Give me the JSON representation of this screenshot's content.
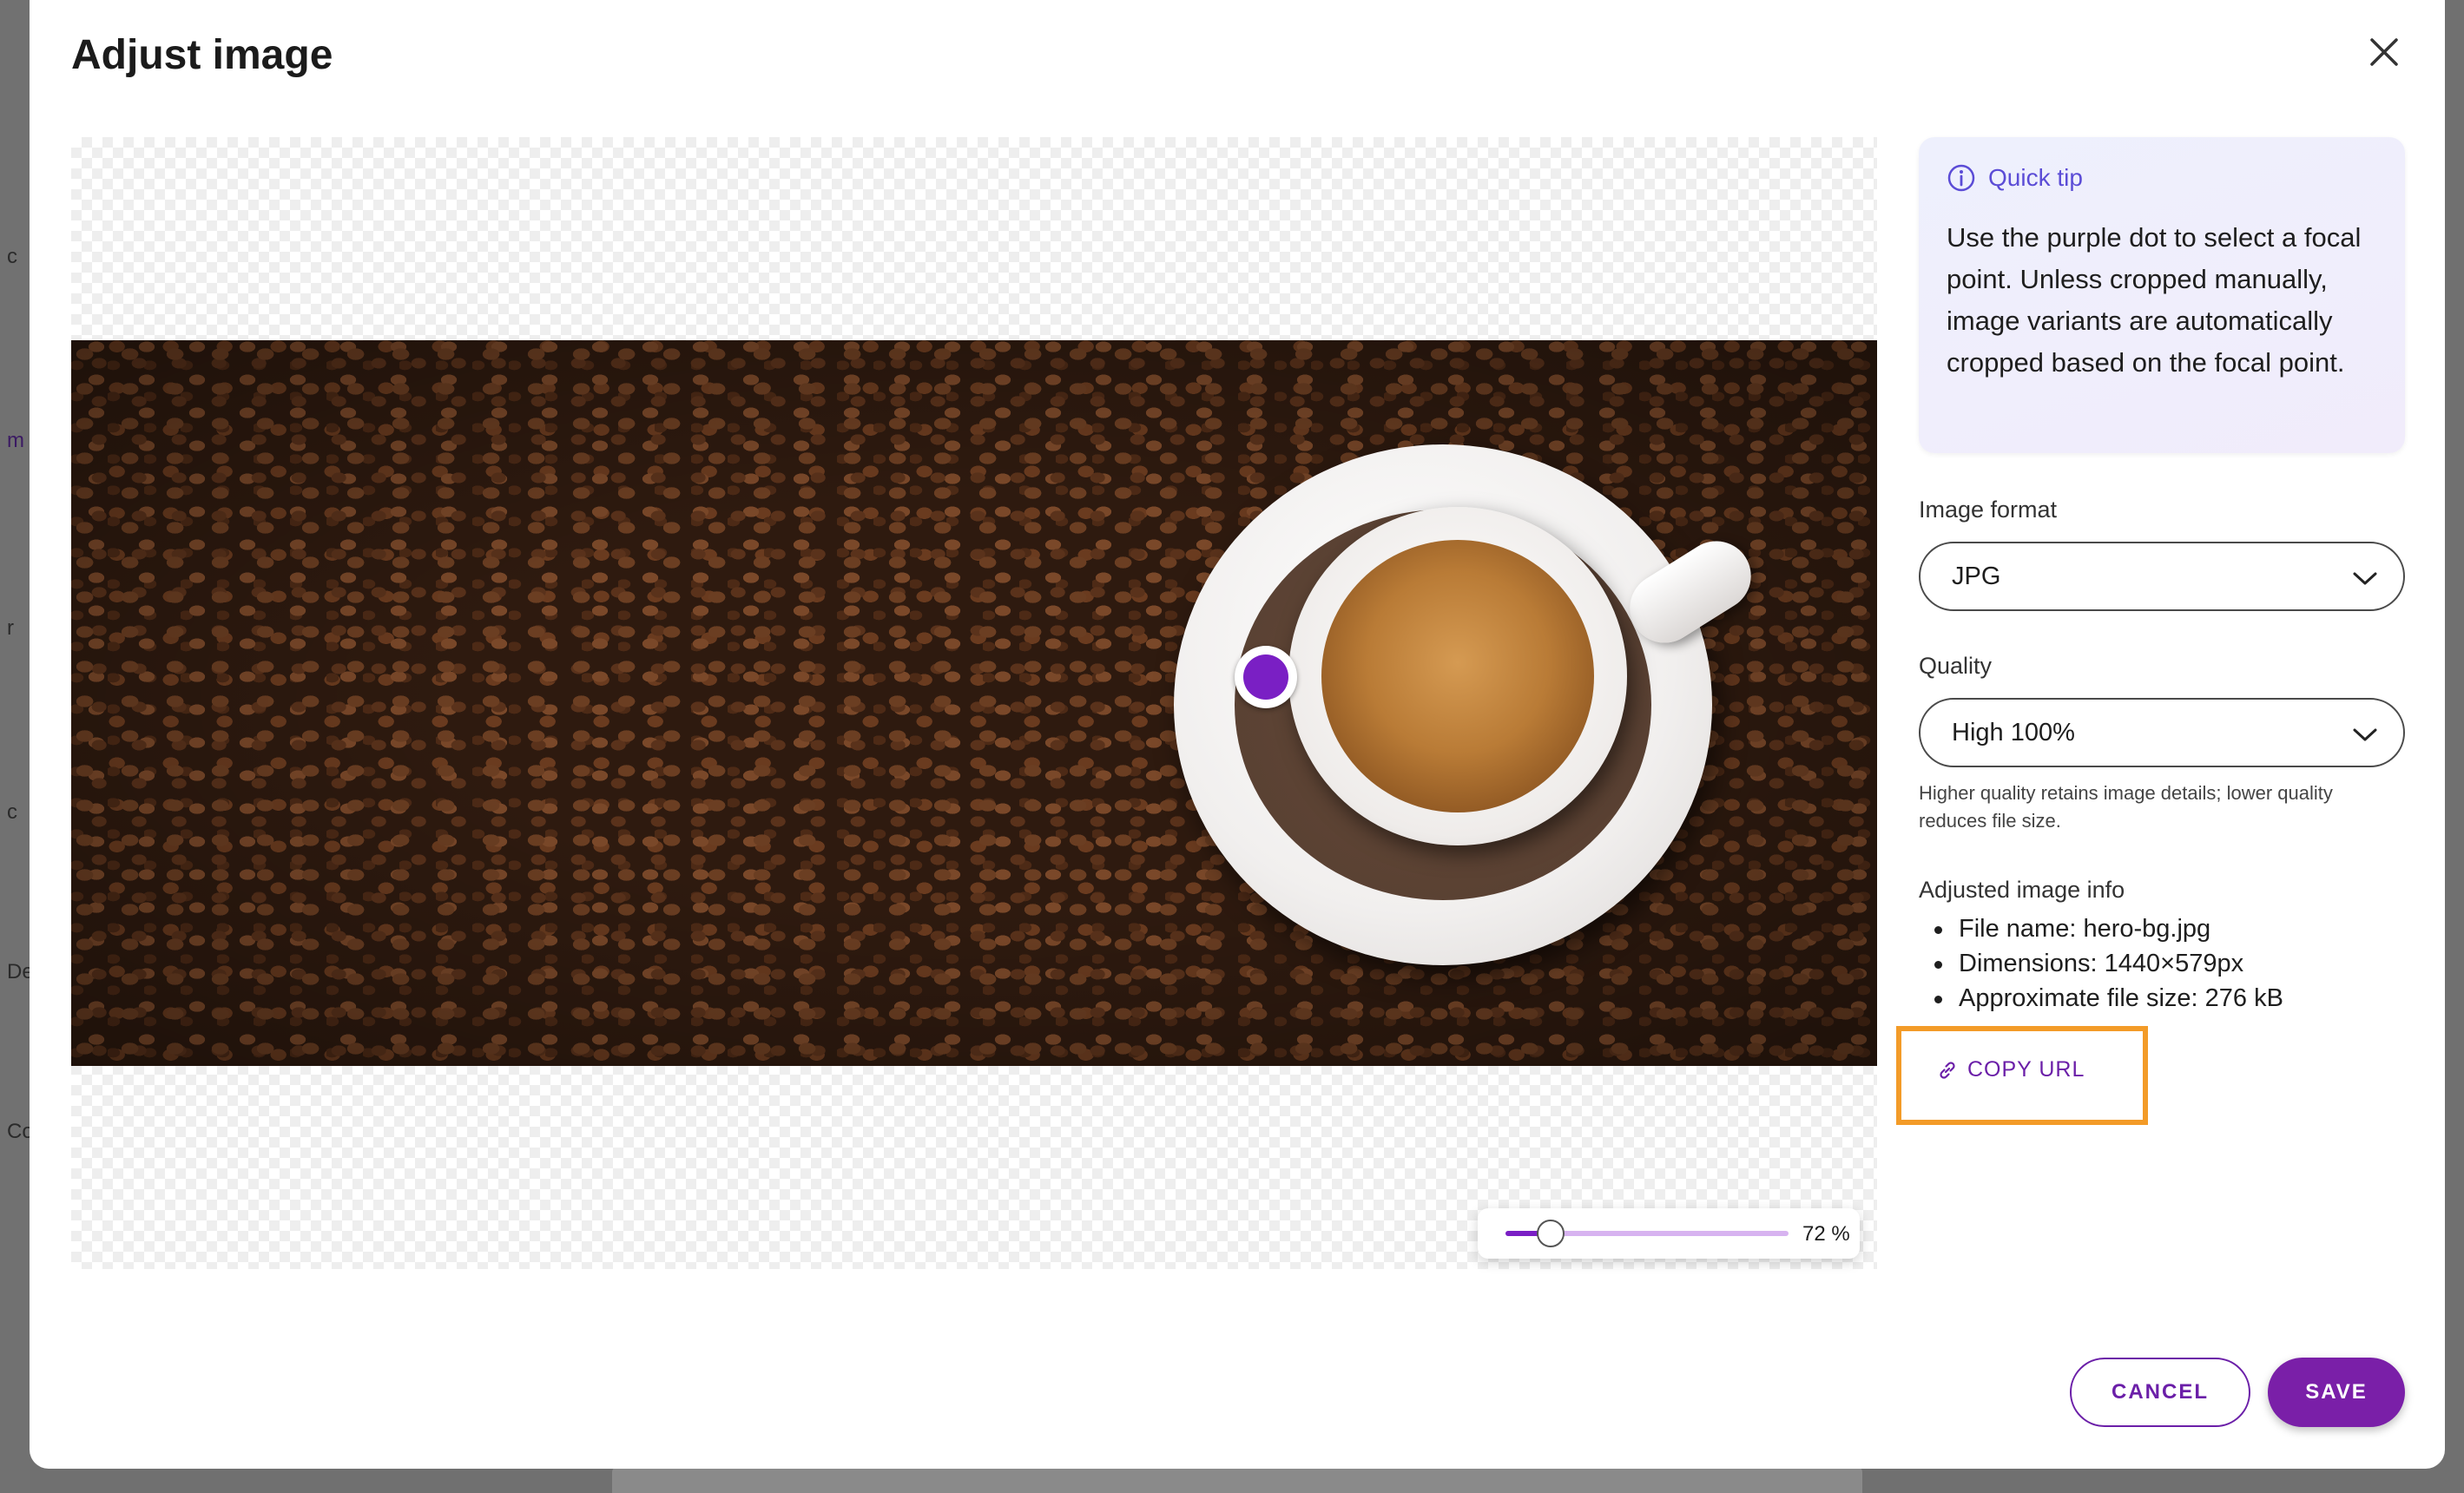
{
  "background_fragments": [
    "c",
    "m",
    "r",
    "c",
    "De",
    "Co"
  ],
  "modal": {
    "title": "Adjust image",
    "close_icon": "close-icon"
  },
  "image": {
    "alt_icon": "focal-point-dot",
    "zoom": {
      "value_percent": 72,
      "min_percent": 0,
      "max_percent": 100,
      "label": "72 %",
      "slider_position_fraction": 0.16
    }
  },
  "tip": {
    "icon": "info-icon",
    "title": "Quick tip",
    "body": "Use the purple dot to select a focal point. Unless cropped manually, image variants are automatically cropped based on the focal point."
  },
  "format": {
    "label": "Image format",
    "value": "JPG"
  },
  "quality": {
    "label": "Quality",
    "value": "High 100%",
    "help": "Higher quality retains image details; lower quality reduces file size."
  },
  "info": {
    "title": "Adjusted image info",
    "items": [
      "File name: hero-bg.jpg",
      "Dimensions: 1440×579px",
      "Approximate file size: 276 kB"
    ]
  },
  "copy_url": {
    "label": "COPY URL",
    "icon": "link-icon"
  },
  "actions": {
    "cancel": "CANCEL",
    "save": "SAVE"
  },
  "colors": {
    "accent": "#7a1fc4",
    "button_primary": "#7a1fa8",
    "tip_title": "#5b4cd6",
    "highlight": "#f39b28"
  }
}
